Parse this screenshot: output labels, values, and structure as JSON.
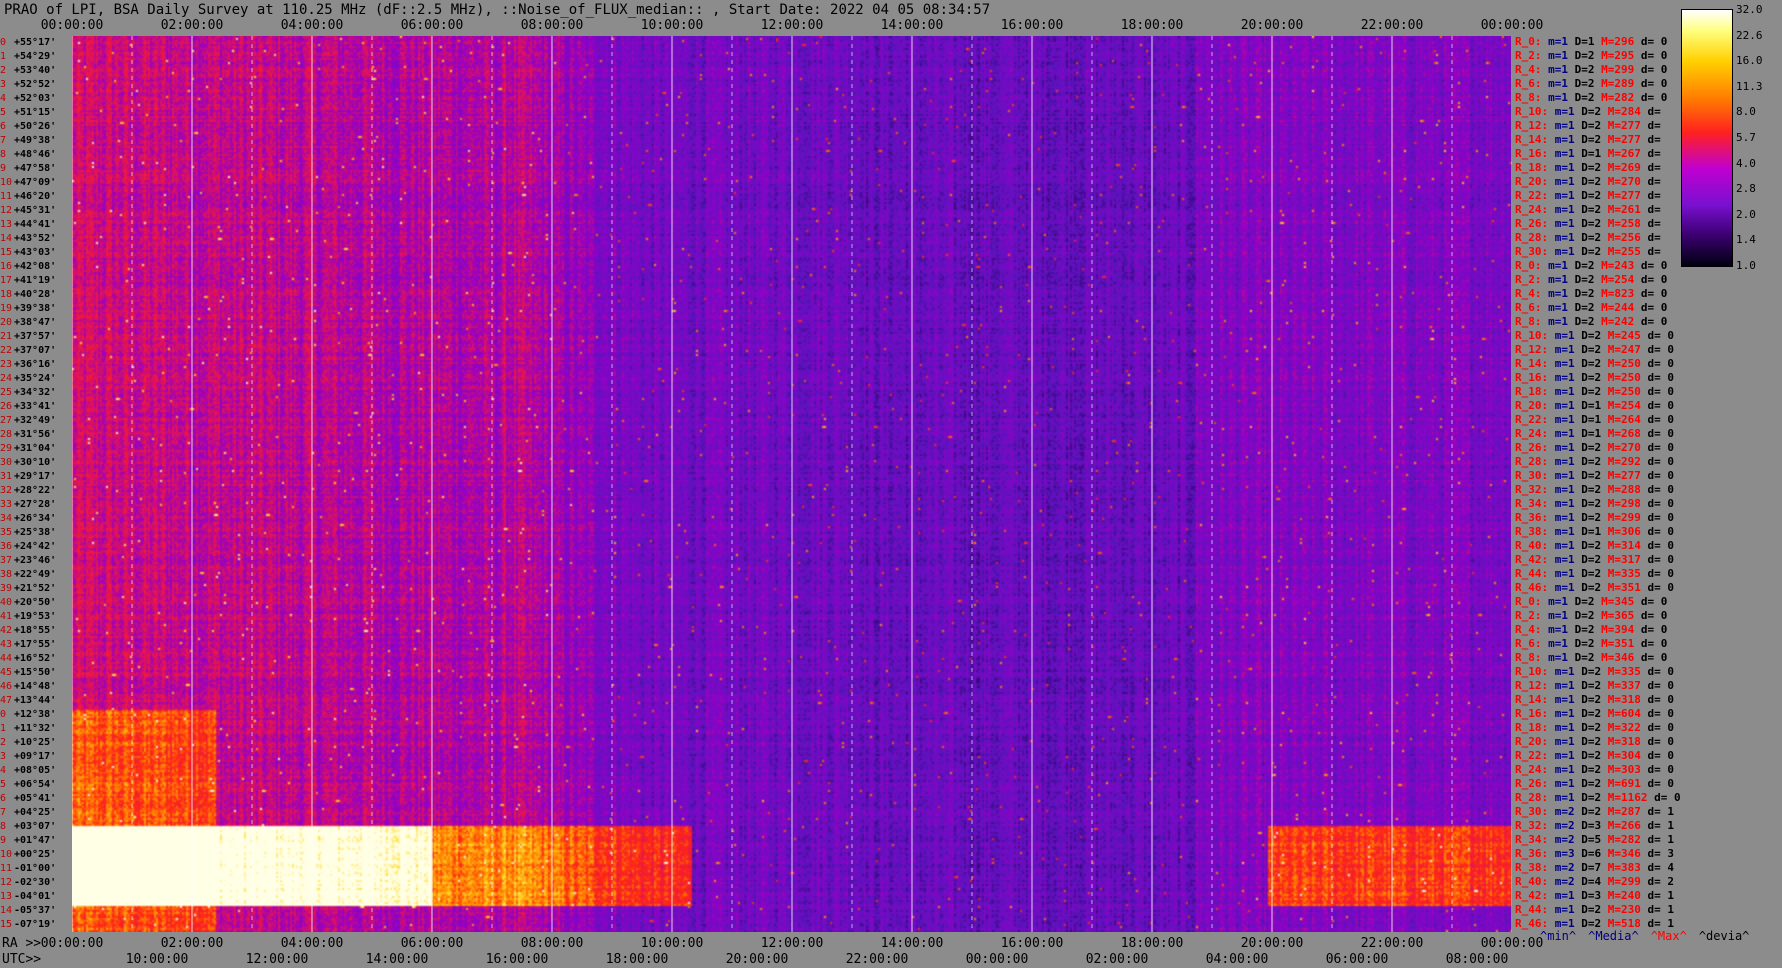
{
  "title": "PRAO of LPI, BSA Daily Survey at 110.25 MHz (dF::2.5 MHz), ::Noise_of_FLUX_median:: , Start Date: 2022 04 05 08:34:57",
  "axis_labels": {
    "ra_prefix": "RA >>",
    "utc_prefix": "UTC>>"
  },
  "chart_data": {
    "type": "heatmap",
    "title": "PRAO of LPI, BSA Daily Survey at 110.25 MHz (dF::2.5 MHz), ::Noise_of_FLUX_median:: , Start Date: 2022 04 05 08:34:57",
    "x_top_ticks": [
      "00:00:00",
      "02:00:00",
      "04:00:00",
      "06:00:00",
      "08:00:00",
      "10:00:00",
      "12:00:00",
      "14:00:00",
      "16:00:00",
      "18:00:00",
      "20:00:00",
      "22:00:00",
      "00:00:00"
    ],
    "x_ra_ticks": [
      "00:00:00",
      "02:00:00",
      "04:00:00",
      "06:00:00",
      "08:00:00",
      "10:00:00",
      "12:00:00",
      "14:00:00",
      "16:00:00",
      "18:00:00",
      "20:00:00",
      "22:00:00",
      "00:00:00"
    ],
    "x_utc_ticks": [
      "10:00:00",
      "12:00:00",
      "14:00:00",
      "16:00:00",
      "18:00:00",
      "20:00:00",
      "22:00:00",
      "00:00:00",
      "02:00:00",
      "04:00:00",
      "06:00:00",
      "08:00:00"
    ],
    "y_beams": [
      {
        "idx": "0",
        "dec": "+55°17'"
      },
      {
        "idx": "1",
        "dec": "+54°29'"
      },
      {
        "idx": "2",
        "dec": "+53°40'"
      },
      {
        "idx": "3",
        "dec": "+52°52'"
      },
      {
        "idx": "4",
        "dec": "+52°03'"
      },
      {
        "idx": "5",
        "dec": "+51°15'"
      },
      {
        "idx": "6",
        "dec": "+50°26'"
      },
      {
        "idx": "7",
        "dec": "+49°38'"
      },
      {
        "idx": "8",
        "dec": "+48°46'"
      },
      {
        "idx": "9",
        "dec": "+47°58'"
      },
      {
        "idx": "10",
        "dec": "+47°09'"
      },
      {
        "idx": "11",
        "dec": "+46°20'"
      },
      {
        "idx": "12",
        "dec": "+45°31'"
      },
      {
        "idx": "13",
        "dec": "+44°41'"
      },
      {
        "idx": "14",
        "dec": "+43°52'"
      },
      {
        "idx": "15",
        "dec": "+43°03'"
      },
      {
        "idx": "16",
        "dec": "+42°08'"
      },
      {
        "idx": "17",
        "dec": "+41°19'"
      },
      {
        "idx": "18",
        "dec": "+40°28'"
      },
      {
        "idx": "19",
        "dec": "+39°38'"
      },
      {
        "idx": "20",
        "dec": "+38°47'"
      },
      {
        "idx": "21",
        "dec": "+37°57'"
      },
      {
        "idx": "22",
        "dec": "+37°07'"
      },
      {
        "idx": "23",
        "dec": "+36°16'"
      },
      {
        "idx": "24",
        "dec": "+35°24'"
      },
      {
        "idx": "25",
        "dec": "+34°32'"
      },
      {
        "idx": "26",
        "dec": "+33°41'"
      },
      {
        "idx": "27",
        "dec": "+32°49'"
      },
      {
        "idx": "28",
        "dec": "+31°56'"
      },
      {
        "idx": "29",
        "dec": "+31°04'"
      },
      {
        "idx": "30",
        "dec": "+30°10'"
      },
      {
        "idx": "31",
        "dec": "+29°17'"
      },
      {
        "idx": "32",
        "dec": "+28°22'"
      },
      {
        "idx": "33",
        "dec": "+27°28'"
      },
      {
        "idx": "34",
        "dec": "+26°34'"
      },
      {
        "idx": "35",
        "dec": "+25°38'"
      },
      {
        "idx": "36",
        "dec": "+24°42'"
      },
      {
        "idx": "37",
        "dec": "+23°46'"
      },
      {
        "idx": "38",
        "dec": "+22°49'"
      },
      {
        "idx": "39",
        "dec": "+21°52'"
      },
      {
        "idx": "40",
        "dec": "+20°50'"
      },
      {
        "idx": "41",
        "dec": "+19°53'"
      },
      {
        "idx": "42",
        "dec": "+18°55'"
      },
      {
        "idx": "43",
        "dec": "+17°55'"
      },
      {
        "idx": "44",
        "dec": "+16°52'"
      },
      {
        "idx": "45",
        "dec": "+15°50'"
      },
      {
        "idx": "46",
        "dec": "+14°48'"
      },
      {
        "idx": "47",
        "dec": "+13°44'"
      },
      {
        "idx": "0",
        "dec": "+12°38'"
      },
      {
        "idx": "1",
        "dec": "+11°32'"
      },
      {
        "idx": "2",
        "dec": "+10°25'"
      },
      {
        "idx": "3",
        "dec": "+09°17'"
      },
      {
        "idx": "4",
        "dec": "+08°05'"
      },
      {
        "idx": "5",
        "dec": "+06°54'"
      },
      {
        "idx": "6",
        "dec": "+05°41'"
      },
      {
        "idx": "7",
        "dec": "+04°25'"
      },
      {
        "idx": "8",
        "dec": "+03°07'"
      },
      {
        "idx": "9",
        "dec": "+01°47'"
      },
      {
        "idx": "10",
        "dec": "+00°25'"
      },
      {
        "idx": "11",
        "dec": "-01°00'"
      },
      {
        "idx": "12",
        "dec": "-02°30'"
      },
      {
        "idx": "13",
        "dec": "-04°01'"
      },
      {
        "idx": "14",
        "dec": "-05°37'"
      },
      {
        "idx": "15",
        "dec": "-07°19'"
      }
    ],
    "beam_stats": [
      {
        "r": "R_0:",
        "m": "m=1",
        "d": "D=1",
        "M": "M=296",
        "dv": "d= 0"
      },
      {
        "r": "R_2:",
        "m": "m=1",
        "d": "D=2",
        "M": "M=295",
        "dv": "d= 0"
      },
      {
        "r": "R_4:",
        "m": "m=1",
        "d": "D=2",
        "M": "M=299",
        "dv": "d= 0"
      },
      {
        "r": "R_6:",
        "m": "m=1",
        "d": "D=2",
        "M": "M=289",
        "dv": "d= 0"
      },
      {
        "r": "R_8:",
        "m": "m=1",
        "d": "D=2",
        "M": "M=282",
        "dv": "d= 0"
      },
      {
        "r": "R_10:",
        "m": "m=1",
        "d": "D=2",
        "M": "M=284",
        "dv": "d="
      },
      {
        "r": "R_12:",
        "m": "m=1",
        "d": "D=2",
        "M": "M=277",
        "dv": "d="
      },
      {
        "r": "R_14:",
        "m": "m=1",
        "d": "D=2",
        "M": "M=277",
        "dv": "d="
      },
      {
        "r": "R_16:",
        "m": "m=1",
        "d": "D=1",
        "M": "M=267",
        "dv": "d="
      },
      {
        "r": "R_18:",
        "m": "m=1",
        "d": "D=2",
        "M": "M=269",
        "dv": "d="
      },
      {
        "r": "R_20:",
        "m": "m=1",
        "d": "D=2",
        "M": "M=270",
        "dv": "d="
      },
      {
        "r": "R_22:",
        "m": "m=1",
        "d": "D=2",
        "M": "M=277",
        "dv": "d="
      },
      {
        "r": "R_24:",
        "m": "m=1",
        "d": "D=2",
        "M": "M=261",
        "dv": "d="
      },
      {
        "r": "R_26:",
        "m": "m=1",
        "d": "D=2",
        "M": "M=258",
        "dv": "d="
      },
      {
        "r": "R_28:",
        "m": "m=1",
        "d": "D=2",
        "M": "M=256",
        "dv": "d="
      },
      {
        "r": "R_30:",
        "m": "m=1",
        "d": "D=2",
        "M": "M=255",
        "dv": "d="
      },
      {
        "r": "R_0:",
        "m": "m=1",
        "d": "D=2",
        "M": "M=243",
        "dv": "d= 0"
      },
      {
        "r": "R_2:",
        "m": "m=1",
        "d": "D=2",
        "M": "M=254",
        "dv": "d= 0"
      },
      {
        "r": "R_4:",
        "m": "m=1",
        "d": "D=2",
        "M": "M=823",
        "dv": "d= 0"
      },
      {
        "r": "R_6:",
        "m": "m=1",
        "d": "D=2",
        "M": "M=244",
        "dv": "d= 0"
      },
      {
        "r": "R_8:",
        "m": "m=1",
        "d": "D=2",
        "M": "M=242",
        "dv": "d= 0"
      },
      {
        "r": "R_10:",
        "m": "m=1",
        "d": "D=2",
        "M": "M=245",
        "dv": "d= 0"
      },
      {
        "r": "R_12:",
        "m": "m=1",
        "d": "D=2",
        "M": "M=247",
        "dv": "d= 0"
      },
      {
        "r": "R_14:",
        "m": "m=1",
        "d": "D=2",
        "M": "M=250",
        "dv": "d= 0"
      },
      {
        "r": "R_16:",
        "m": "m=1",
        "d": "D=2",
        "M": "M=250",
        "dv": "d= 0"
      },
      {
        "r": "R_18:",
        "m": "m=1",
        "d": "D=2",
        "M": "M=250",
        "dv": "d= 0"
      },
      {
        "r": "R_20:",
        "m": "m=1",
        "d": "D=1",
        "M": "M=254",
        "dv": "d= 0"
      },
      {
        "r": "R_22:",
        "m": "m=1",
        "d": "D=1",
        "M": "M=264",
        "dv": "d= 0"
      },
      {
        "r": "R_24:",
        "m": "m=1",
        "d": "D=1",
        "M": "M=268",
        "dv": "d= 0"
      },
      {
        "r": "R_26:",
        "m": "m=1",
        "d": "D=2",
        "M": "M=270",
        "dv": "d= 0"
      },
      {
        "r": "R_28:",
        "m": "m=1",
        "d": "D=2",
        "M": "M=292",
        "dv": "d= 0"
      },
      {
        "r": "R_30:",
        "m": "m=1",
        "d": "D=2",
        "M": "M=277",
        "dv": "d= 0"
      },
      {
        "r": "R_32:",
        "m": "m=1",
        "d": "D=2",
        "M": "M=288",
        "dv": "d= 0"
      },
      {
        "r": "R_34:",
        "m": "m=1",
        "d": "D=2",
        "M": "M=298",
        "dv": "d= 0"
      },
      {
        "r": "R_36:",
        "m": "m=1",
        "d": "D=2",
        "M": "M=299",
        "dv": "d= 0"
      },
      {
        "r": "R_38:",
        "m": "m=1",
        "d": "D=1",
        "M": "M=306",
        "dv": "d= 0"
      },
      {
        "r": "R_40:",
        "m": "m=1",
        "d": "D=2",
        "M": "M=314",
        "dv": "d= 0"
      },
      {
        "r": "R_42:",
        "m": "m=1",
        "d": "D=2",
        "M": "M=317",
        "dv": "d= 0"
      },
      {
        "r": "R_44:",
        "m": "m=1",
        "d": "D=2",
        "M": "M=335",
        "dv": "d= 0"
      },
      {
        "r": "R_46:",
        "m": "m=1",
        "d": "D=2",
        "M": "M=351",
        "dv": "d= 0"
      },
      {
        "r": "R_0:",
        "m": "m=1",
        "d": "D=2",
        "M": "M=345",
        "dv": "d= 0"
      },
      {
        "r": "R_2:",
        "m": "m=1",
        "d": "D=2",
        "M": "M=365",
        "dv": "d= 0"
      },
      {
        "r": "R_4:",
        "m": "m=1",
        "d": "D=2",
        "M": "M=394",
        "dv": "d= 0"
      },
      {
        "r": "R_6:",
        "m": "m=1",
        "d": "D=2",
        "M": "M=351",
        "dv": "d= 0"
      },
      {
        "r": "R_8:",
        "m": "m=1",
        "d": "D=2",
        "M": "M=346",
        "dv": "d= 0"
      },
      {
        "r": "R_10:",
        "m": "m=1",
        "d": "D=2",
        "M": "M=335",
        "dv": "d= 0"
      },
      {
        "r": "R_12:",
        "m": "m=1",
        "d": "D=2",
        "M": "M=337",
        "dv": "d= 0"
      },
      {
        "r": "R_14:",
        "m": "m=1",
        "d": "D=2",
        "M": "M=318",
        "dv": "d= 0"
      },
      {
        "r": "R_16:",
        "m": "m=1",
        "d": "D=2",
        "M": "M=604",
        "dv": "d= 0"
      },
      {
        "r": "R_18:",
        "m": "m=1",
        "d": "D=2",
        "M": "M=322",
        "dv": "d= 0"
      },
      {
        "r": "R_20:",
        "m": "m=1",
        "d": "D=2",
        "M": "M=318",
        "dv": "d= 0"
      },
      {
        "r": "R_22:",
        "m": "m=1",
        "d": "D=2",
        "M": "M=304",
        "dv": "d= 0"
      },
      {
        "r": "R_24:",
        "m": "m=1",
        "d": "D=2",
        "M": "M=303",
        "dv": "d= 0"
      },
      {
        "r": "R_26:",
        "m": "m=1",
        "d": "D=2",
        "M": "M=691",
        "dv": "d= 0"
      },
      {
        "r": "R_28:",
        "m": "m=1",
        "d": "D=2",
        "M": "M=1162",
        "dv": "d= 0"
      },
      {
        "r": "R_30:",
        "m": "m=2",
        "d": "D=2",
        "M": "M=287",
        "dv": "d= 1"
      },
      {
        "r": "R_32:",
        "m": "m=2",
        "d": "D=3",
        "M": "M=266",
        "dv": "d= 1"
      },
      {
        "r": "R_34:",
        "m": "m=2",
        "d": "D=5",
        "M": "M=282",
        "dv": "d= 1"
      },
      {
        "r": "R_36:",
        "m": "m=3",
        "d": "D=6",
        "M": "M=346",
        "dv": "d= 3"
      },
      {
        "r": "R_38:",
        "m": "m=2",
        "d": "D=7",
        "M": "M=383",
        "dv": "d= 4"
      },
      {
        "r": "R_40:",
        "m": "m=2",
        "d": "D=4",
        "M": "M=299",
        "dv": "d= 2"
      },
      {
        "r": "R_42:",
        "m": "m=1",
        "d": "D=3",
        "M": "M=240",
        "dv": "d= 1"
      },
      {
        "r": "R_44:",
        "m": "m=1",
        "d": "D=2",
        "M": "M=230",
        "dv": "d= 1"
      },
      {
        "r": "R_46:",
        "m": "m=1",
        "d": "D=2",
        "M": "M=518",
        "dv": "d= 1"
      }
    ],
    "colorbar_ticks": [
      "32.0",
      "22.6",
      "16.0",
      "11.3",
      "8.0",
      "5.7",
      "4.0",
      "2.8",
      "2.0",
      "1.4",
      "1.0"
    ],
    "legend": [
      "^min^",
      "^Media^",
      "^Max^",
      "^devia^"
    ],
    "colors": {
      "background": "#8c8c8c",
      "legend_min": "#000080",
      "legend_media": "#000080",
      "legend_max": "#ff0000",
      "legend_devia": "#000000"
    }
  }
}
